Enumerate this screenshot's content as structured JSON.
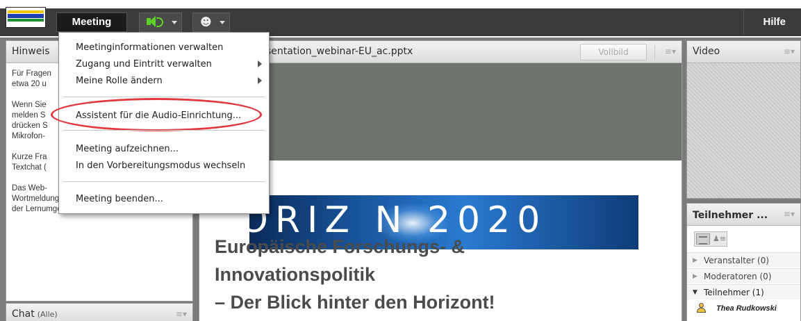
{
  "topbar": {
    "meeting_menu_label": "Meeting",
    "help_label": "Hilfe"
  },
  "meeting_menu": {
    "items": [
      {
        "label": "Meetinginformationen verwalten",
        "has_submenu": false
      },
      {
        "label": "Zugang und Eintritt verwalten",
        "has_submenu": true
      },
      {
        "label": "Meine Rolle ändern",
        "has_submenu": true
      },
      {
        "label": "Assistent für die Audio-Einrichtung...",
        "has_submenu": false,
        "highlighted": true
      },
      {
        "label": "Meeting aufzeichnen...",
        "has_submenu": false
      },
      {
        "label": "In den Vorbereitungsmodus wechseln",
        "has_submenu": false
      },
      {
        "label": "Meeting beenden...",
        "has_submenu": false
      }
    ],
    "highlight_color": "#e0383e"
  },
  "notes_pod": {
    "title": "Hinweis",
    "paragraphs": [
      "Für Fragen\netwa 20 u",
      "Wenn Sie\nmelden S\ndrücken S\nMikrofon-",
      "Kurze Fra\nTextchat (",
      "Das Web-\nWortmeldungen aufgezeichnet. Es wird in\nder Lernumgebung veröffentlicht."
    ]
  },
  "chat_pod": {
    "title": "Chat",
    "scope": "(Alle)"
  },
  "share_pod": {
    "title": "sentation_webinar-EU_ac.pptx",
    "fullscreen_label": "Vollbild",
    "banner_text": "ORIZ  N 2020",
    "slide_title_lines": [
      "Europäische Forschungs- &",
      "Innovationspolitik",
      "– Der Blick hinter den Horizont!"
    ]
  },
  "video_pod": {
    "title": "Video"
  },
  "attendees_pod": {
    "title": "Teilnehmer ...",
    "groups": [
      {
        "label": "Veranstalter (0)",
        "expanded": false
      },
      {
        "label": "Moderatoren (0)",
        "expanded": false
      },
      {
        "label": "Teilnehmer (1)",
        "expanded": true
      }
    ],
    "attendee_name": "Thea Rudkowski"
  },
  "colors": {
    "topbar_bg": "#3b3b3b",
    "audio_icon": "#5fcf2a",
    "slide_title": "#4b4b4b"
  },
  "icons": [
    "app-logo-icon",
    "speaker-icon",
    "camera-person-icon",
    "pod-menu-icon",
    "list-view-icon",
    "grid-view-icon",
    "attendee-icon"
  ]
}
